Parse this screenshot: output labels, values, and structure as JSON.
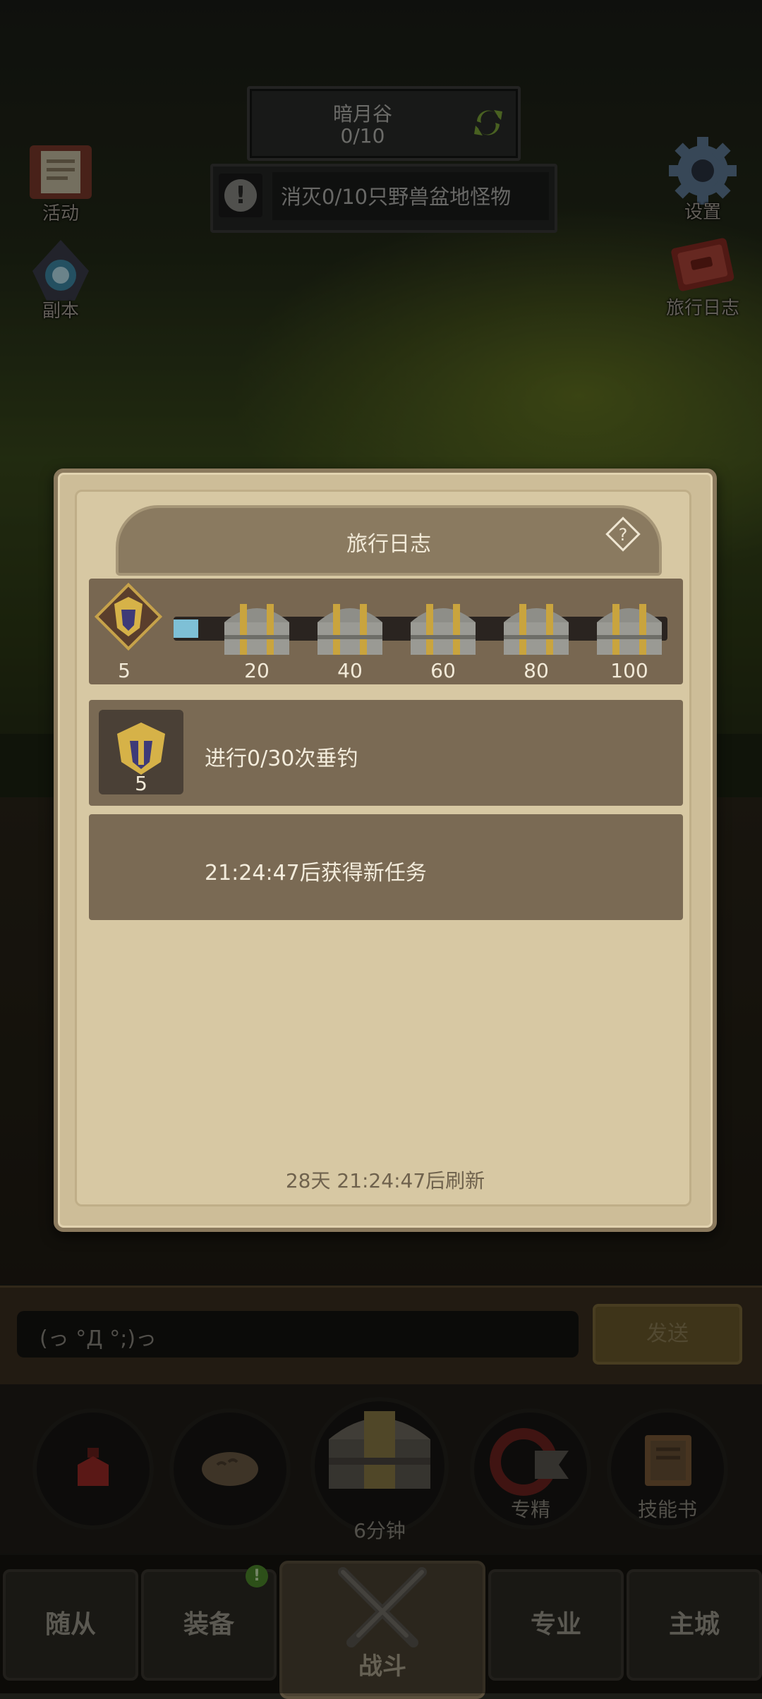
{
  "hud": {
    "zone_name": "暗月谷",
    "zone_progress": "0/10",
    "quest_text": "消灭0/10只野兽盆地怪物"
  },
  "side_buttons": {
    "activity": "活动",
    "dungeon": "副本",
    "settings": "设置",
    "travel_log": "旅行日志"
  },
  "chat": {
    "input_value": "(っ °Д °;)っ",
    "send_label": "发送"
  },
  "skills": {
    "chest_timer": "6分钟",
    "specialize": "专精",
    "skill_book": "技能书"
  },
  "nav": {
    "followers": "随从",
    "equipment": "装备",
    "battle": "战斗",
    "profession": "专业",
    "main_city": "主城",
    "equipment_badge": "!"
  },
  "modal": {
    "title": "旅行日志",
    "current_points": "5",
    "progress_fraction": 0.05,
    "milestones": [
      "20",
      "40",
      "60",
      "80",
      "100"
    ],
    "task": {
      "reward": "5",
      "text": "进行0/30次垂钓"
    },
    "next_task_text": "21:24:47后获得新任务",
    "refresh_text": "28天 21:24:47后刷新"
  }
}
